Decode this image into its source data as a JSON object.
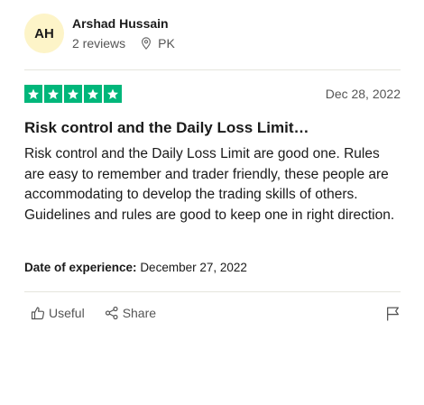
{
  "reviewer": {
    "initials": "AH",
    "name": "Arshad Hussain",
    "reviews": "2 reviews",
    "country": "PK"
  },
  "review": {
    "rating": 5,
    "date": "Dec 28, 2022",
    "title": "Risk control and the Daily Loss Limit…",
    "body": "Risk control and the Daily Loss Limit are good one. Rules are easy to remember and trader friendly, these people are accommodating to develop the trading skills of others. Guidelines and rules are good to keep one in right direction.",
    "experience_label": "Date of experience:",
    "experience_date": "December 27, 2022"
  },
  "actions": {
    "useful_label": "Useful",
    "share_label": "Share"
  },
  "colors": {
    "star": "#00b67a",
    "avatar_bg": "#fdf4c8"
  }
}
